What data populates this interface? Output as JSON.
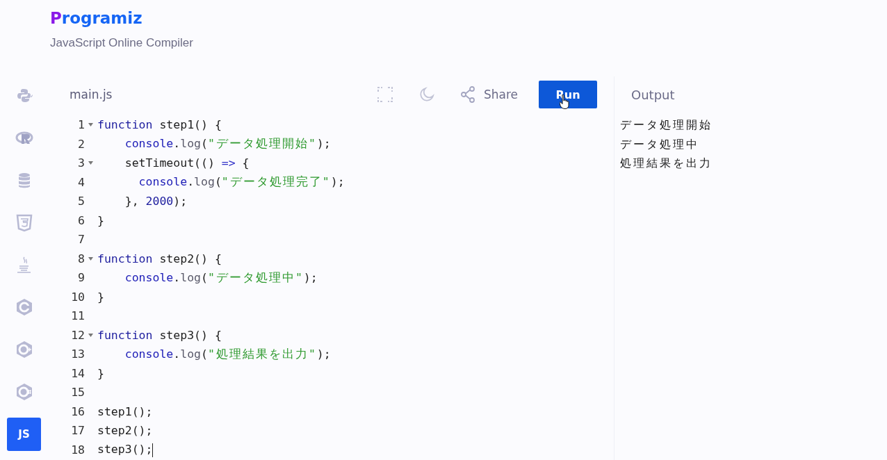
{
  "header": {
    "logo": "Programiz",
    "subtitle": "JavaScript Online Compiler"
  },
  "sidebar": {
    "items": [
      {
        "kind": "python",
        "selected": false
      },
      {
        "kind": "r",
        "selected": false
      },
      {
        "kind": "database",
        "selected": false
      },
      {
        "kind": "html",
        "selected": false
      },
      {
        "kind": "java",
        "selected": false
      },
      {
        "kind": "c",
        "selected": false
      },
      {
        "kind": "cpp",
        "selected": false
      },
      {
        "kind": "csharp",
        "selected": false
      },
      {
        "kind": "js",
        "label": "JS",
        "selected": true
      }
    ]
  },
  "editor": {
    "tab": "main.js",
    "share_label": "Share",
    "run_label": "Run",
    "lines": [
      {
        "number": "1",
        "foldable": true,
        "tokens": [
          {
            "kind": "keyword",
            "text": "function"
          },
          {
            "kind": "plain",
            "text": " step1() {"
          }
        ]
      },
      {
        "number": "2",
        "foldable": false,
        "tokens": [
          {
            "kind": "variable",
            "text": "    console"
          },
          {
            "kind": "plain",
            "text": "."
          },
          {
            "kind": "property",
            "text": "log"
          },
          {
            "kind": "plain",
            "text": "("
          },
          {
            "kind": "string",
            "text": "\"データ処理開始\""
          },
          {
            "kind": "plain",
            "text": ");"
          }
        ]
      },
      {
        "number": "3",
        "foldable": true,
        "tokens": [
          {
            "kind": "plain",
            "text": "    setTimeout(() "
          },
          {
            "kind": "operator",
            "text": "=>"
          },
          {
            "kind": "plain",
            "text": " {"
          }
        ]
      },
      {
        "number": "4",
        "foldable": false,
        "tokens": [
          {
            "kind": "variable",
            "text": "      console"
          },
          {
            "kind": "plain",
            "text": "."
          },
          {
            "kind": "property",
            "text": "log"
          },
          {
            "kind": "plain",
            "text": "("
          },
          {
            "kind": "string",
            "text": "\"データ処理完了\""
          },
          {
            "kind": "plain",
            "text": ");"
          }
        ]
      },
      {
        "number": "5",
        "foldable": false,
        "tokens": [
          {
            "kind": "plain",
            "text": "    }, "
          },
          {
            "kind": "number",
            "text": "2000"
          },
          {
            "kind": "plain",
            "text": ");"
          }
        ]
      },
      {
        "number": "6",
        "foldable": false,
        "tokens": [
          {
            "kind": "plain",
            "text": "}"
          }
        ]
      },
      {
        "number": "7",
        "foldable": false
      },
      {
        "number": "8",
        "foldable": true,
        "tokens": [
          {
            "kind": "keyword",
            "text": "function"
          },
          {
            "kind": "plain",
            "text": " step2() {"
          }
        ]
      },
      {
        "number": "9",
        "foldable": false,
        "tokens": [
          {
            "kind": "variable",
            "text": "    console"
          },
          {
            "kind": "plain",
            "text": "."
          },
          {
            "kind": "property",
            "text": "log"
          },
          {
            "kind": "plain",
            "text": "("
          },
          {
            "kind": "string",
            "text": "\"データ処理中\""
          },
          {
            "kind": "plain",
            "text": ");"
          }
        ]
      },
      {
        "number": "10",
        "foldable": false,
        "tokens": [
          {
            "kind": "plain",
            "text": "}"
          }
        ]
      },
      {
        "number": "11",
        "foldable": false
      },
      {
        "number": "12",
        "foldable": true,
        "tokens": [
          {
            "kind": "keyword",
            "text": "function"
          },
          {
            "kind": "plain",
            "text": " step3() {"
          }
        ]
      },
      {
        "number": "13",
        "foldable": false,
        "tokens": [
          {
            "kind": "variable",
            "text": "    console"
          },
          {
            "kind": "plain",
            "text": "."
          },
          {
            "kind": "property",
            "text": "log"
          },
          {
            "kind": "plain",
            "text": "("
          },
          {
            "kind": "string",
            "text": "\"処理結果を出力\""
          },
          {
            "kind": "plain",
            "text": ");"
          }
        ]
      },
      {
        "number": "14",
        "foldable": false,
        "tokens": [
          {
            "kind": "plain",
            "text": "}"
          }
        ]
      },
      {
        "number": "15",
        "foldable": false
      },
      {
        "number": "16",
        "foldable": false,
        "tokens": [
          {
            "kind": "plain",
            "text": "step1();"
          }
        ]
      },
      {
        "number": "17",
        "foldable": false,
        "tokens": [
          {
            "kind": "plain",
            "text": "step2();"
          }
        ]
      },
      {
        "number": "18",
        "foldable": false,
        "tokens": [
          {
            "kind": "plain",
            "text": "step3();"
          }
        ]
      }
    ]
  },
  "output": {
    "title": "Output",
    "lines": [
      "データ処理開始",
      "データ処理中",
      "処理結果を出力"
    ]
  }
}
